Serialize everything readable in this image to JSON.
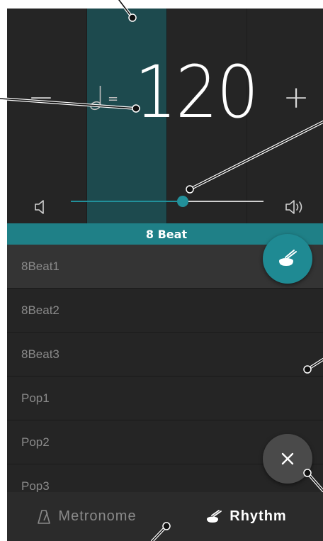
{
  "tempo": {
    "value": "120",
    "note_symbol": "half-note-icon",
    "equals": "=",
    "minus_label": "−",
    "plus_label": "+"
  },
  "beats": {
    "count": 4,
    "active_index": 1
  },
  "volume": {
    "level": 0.58
  },
  "category": {
    "label": "8 Beat"
  },
  "rhythm_list": {
    "items": [
      "8Beat1",
      "8Beat2",
      "8Beat3",
      "Pop1",
      "Pop2",
      "Pop3"
    ],
    "selected_index": 0
  },
  "bottom_nav": {
    "metronome_label": "Metronome",
    "rhythm_label": "Rhythm",
    "active": "rhythm"
  },
  "colors": {
    "accent": "#1f8a93",
    "active_beat": "#1d4a4e",
    "background": "#232323"
  }
}
